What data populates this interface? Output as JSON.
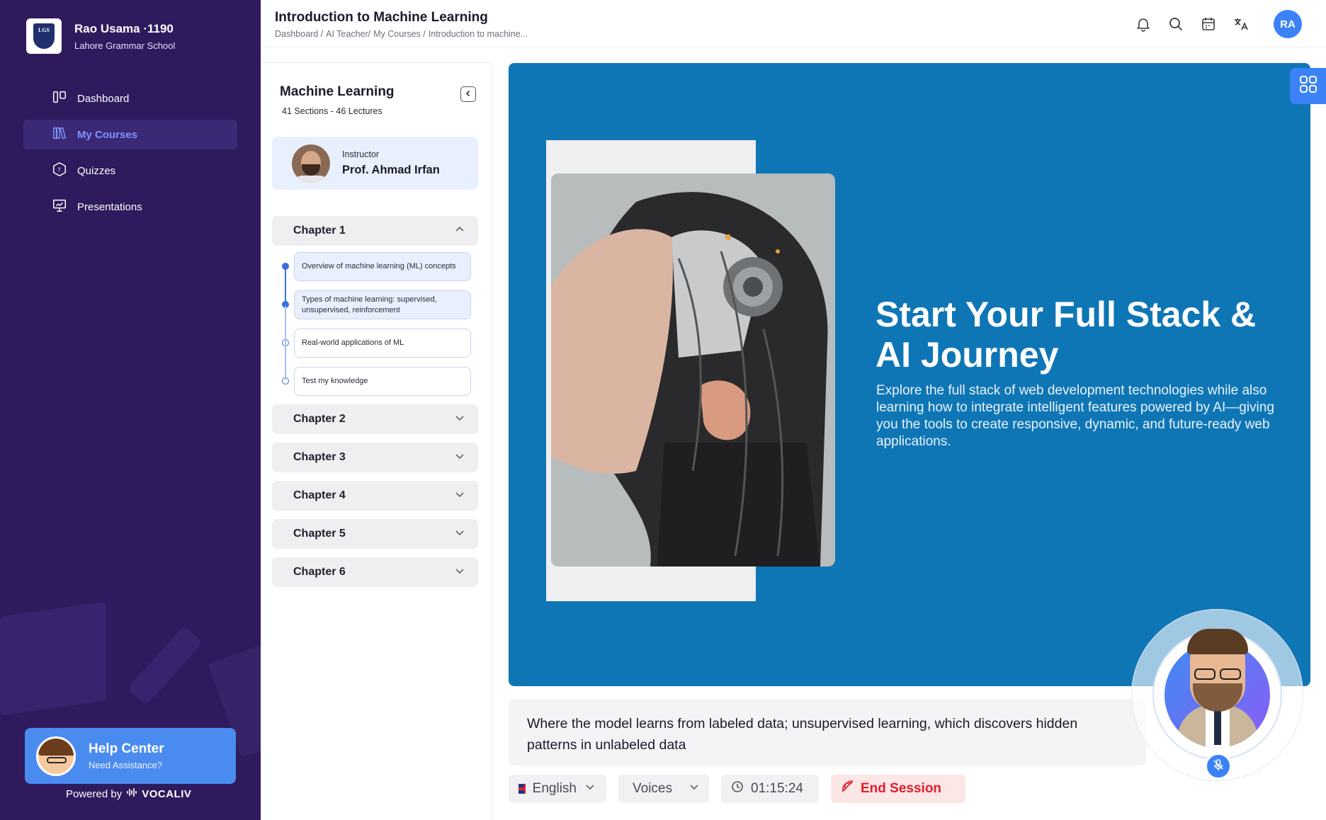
{
  "school": {
    "user_name": "Rao Usama ·1190",
    "school_name": "Lahore Grammar School",
    "logo_text": "LGS"
  },
  "sidebar": {
    "items": [
      {
        "label": "Dashboard",
        "icon": "dashboard-icon"
      },
      {
        "label": "My Courses",
        "icon": "books-icon",
        "active": true
      },
      {
        "label": "Quizzes",
        "icon": "quiz-icon"
      },
      {
        "label": "Presentations",
        "icon": "presentation-icon"
      }
    ],
    "help": {
      "title": "Help Center",
      "subtitle": "Need Assistance?"
    },
    "powered_by": "Powered by",
    "brand": "VOCALIV"
  },
  "header": {
    "title": "Introduction to Machine Learning",
    "breadcrumb": [
      "Dashboard /",
      "AI Teacher/",
      "My Courses /",
      "Introduction to machine..."
    ],
    "icons": [
      "bell-icon",
      "search-icon",
      "calendar-icon",
      "translate-icon"
    ],
    "avatar_initials": "RA"
  },
  "course": {
    "title": "Machine Learning",
    "subtitle": "41 Sections - 46 Lectures",
    "instructor_label": "Instructor",
    "instructor_name": "Prof. Ahmad Irfan",
    "chapters": [
      "Chapter 1",
      "Chapter 2",
      "Chapter 3",
      "Chapter 4",
      "Chapter 5",
      "Chapter 6"
    ],
    "chapter1_lessons": [
      {
        "label": "Overview of machine learning (ML) concepts",
        "completed": true
      },
      {
        "label": "Types of machine learning: supervised, unsupervised, reinforcement",
        "completed": true
      },
      {
        "label": "Real-world applications of ML",
        "completed": false
      },
      {
        "label": "Test my knowledge",
        "completed": false
      }
    ]
  },
  "slide": {
    "heading": "Start Your Full Stack & AI Journey",
    "text": "Explore the full stack of web development technologies while also learning how to integrate intelligent features powered by AI—giving you the tools to create responsive, dynamic, and future-ready web applications.",
    "background_color": "#0f76b6"
  },
  "caption": "Where the model learns from labeled data; unsupervised learning, which discovers hidden patterns in unlabeled data",
  "controls": {
    "language": "English",
    "voices": "Voices",
    "timer": "01:15:24",
    "end_session": "End Session"
  },
  "colors": {
    "sidebar": "#2e1a5c",
    "accent": "#3b82f6",
    "danger": "#e11d2a"
  }
}
